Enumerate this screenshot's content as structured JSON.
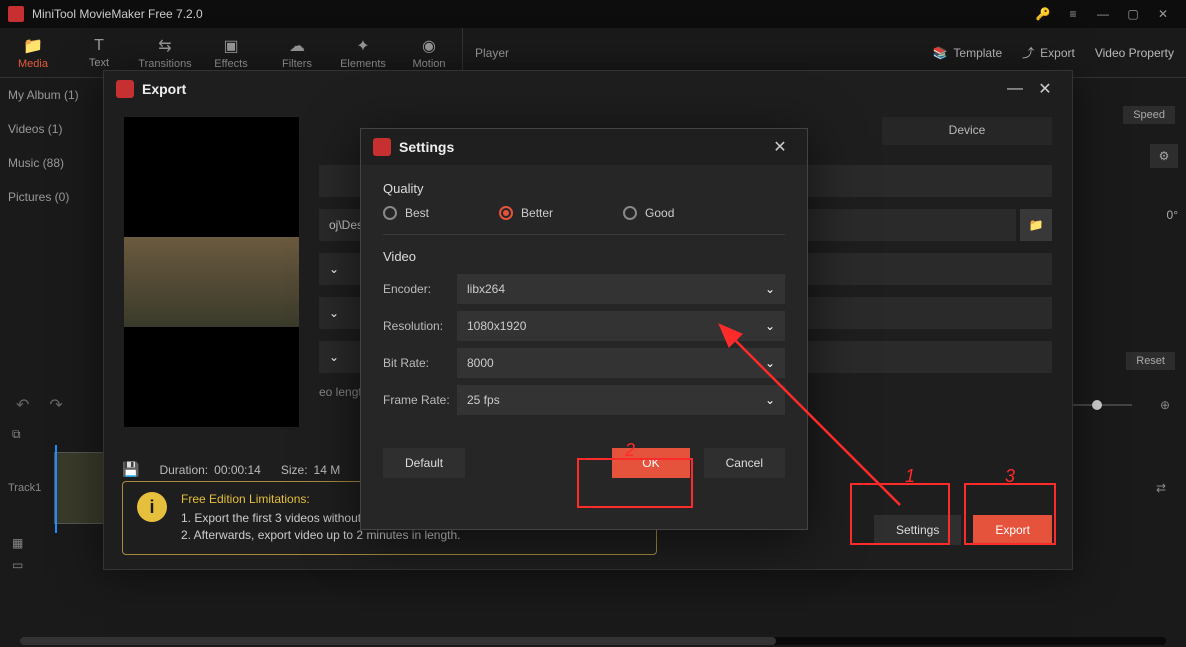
{
  "app": {
    "title": "MiniTool MovieMaker Free 7.2.0"
  },
  "tabs": {
    "media": "Media",
    "text": "Text",
    "transitions": "Transitions",
    "effects": "Effects",
    "filters": "Filters",
    "elements": "Elements",
    "motion": "Motion"
  },
  "header_right": {
    "player": "Player",
    "template": "Template",
    "export": "Export",
    "video_property": "Video Property"
  },
  "sidebar": {
    "items": [
      "My Album (1)",
      "Videos (1)",
      "Music (88)",
      "Pictures (0)"
    ]
  },
  "property": {
    "speed": "Speed",
    "zero_deg": "0°",
    "reset": "Reset"
  },
  "timeline": {
    "track_label": "Track1"
  },
  "export_dialog": {
    "title": "Export",
    "tab_device": "Device",
    "save_to_value": "oj\\Desktop\\My Movie.mp4",
    "duration_label": "Duration:",
    "duration_value": "00:00:14",
    "size_label": "Size:",
    "size_value": "14 M",
    "video_length_hint": "eo length",
    "limitations_title": "Free Edition Limitations:",
    "limit1": "1. Export the first 3 videos without le",
    "limit2": "2. Afterwards, export video up to 2 minutes in length.",
    "settings_btn": "Settings",
    "export_btn": "Export"
  },
  "settings_dialog": {
    "title": "Settings",
    "quality_label": "Quality",
    "q_best": "Best",
    "q_better": "Better",
    "q_good": "Good",
    "video_label": "Video",
    "encoder_label": "Encoder:",
    "encoder_value": "libx264",
    "resolution_label": "Resolution:",
    "resolution_value": "1080x1920",
    "bitrate_label": "Bit Rate:",
    "bitrate_value": "8000",
    "framerate_label": "Frame Rate:",
    "framerate_value": "25 fps",
    "default_btn": "Default",
    "ok_btn": "OK",
    "cancel_btn": "Cancel"
  },
  "annotations": {
    "n1": "1",
    "n2": "2",
    "n3": "3"
  }
}
